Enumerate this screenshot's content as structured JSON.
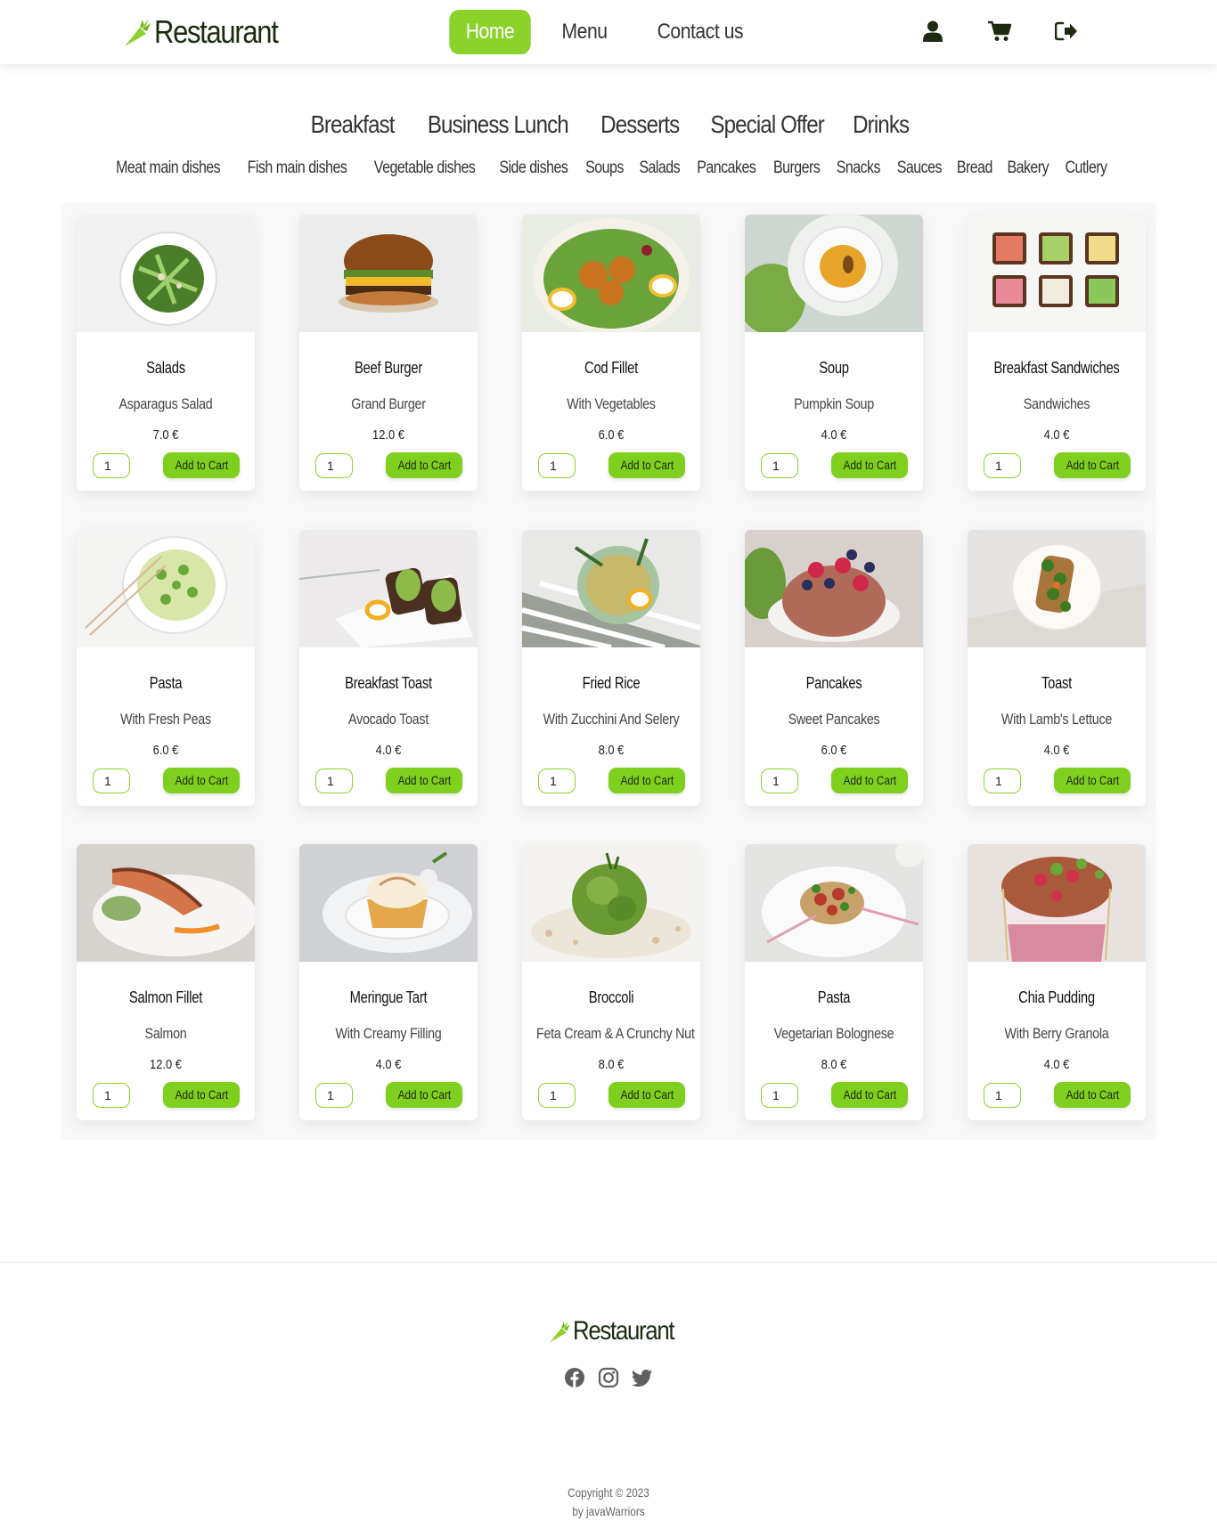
{
  "colors": {
    "accent": "#8bd22b",
    "button": "#7fcf1f",
    "text": "#333333"
  },
  "brand": {
    "name": "Restaurant",
    "logo_icon": "carrot-icon"
  },
  "nav": {
    "items": [
      {
        "label": "Home",
        "active": true
      },
      {
        "label": "Menu",
        "active": false
      },
      {
        "label": "Contact us",
        "active": false
      }
    ],
    "icons": [
      "user-icon",
      "cart-icon",
      "logout-icon"
    ]
  },
  "categories": {
    "main": [
      "Breakfast",
      "Business Lunch",
      "Desserts",
      "Special Offer",
      "Drinks"
    ],
    "sub": [
      "Meat main dishes",
      "Fish main dishes",
      "Vegetable dishes",
      "Side dishes",
      "Soups",
      "Salads",
      "Pancakes",
      "Burgers",
      "Snacks",
      "Sauces",
      "Bread",
      "Bakery",
      "Cutlery"
    ]
  },
  "add_to_cart_label": "Add to Cart",
  "products": [
    {
      "name": "Salads",
      "description": "Asparagus Salad",
      "price": "7.0 €",
      "quantity": "1"
    },
    {
      "name": "Beef Burger",
      "description": "Grand Burger",
      "price": "12.0 €",
      "quantity": "1"
    },
    {
      "name": "Cod Fillet",
      "description": "With Vegetables",
      "price": "6.0 €",
      "quantity": "1"
    },
    {
      "name": "Soup",
      "description": "Pumpkin Soup",
      "price": "4.0 €",
      "quantity": "1"
    },
    {
      "name": "Breakfast Sandwiches",
      "description": "Sandwiches",
      "price": "4.0 €",
      "quantity": "1"
    },
    {
      "name": "Pasta",
      "description": "With Fresh Peas",
      "price": "6.0 €",
      "quantity": "1"
    },
    {
      "name": "Breakfast Toast",
      "description": "Avocado Toast",
      "price": "4.0 €",
      "quantity": "1"
    },
    {
      "name": "Fried Rice",
      "description": "With Zucchini And Selery",
      "price": "8.0 €",
      "quantity": "1"
    },
    {
      "name": "Pancakes",
      "description": "Sweet Pancakes",
      "price": "6.0 €",
      "quantity": "1"
    },
    {
      "name": "Toast",
      "description": "With Lamb's Lettuce",
      "price": "4.0 €",
      "quantity": "1"
    },
    {
      "name": "Salmon Fillet",
      "description": "Salmon",
      "price": "12.0 €",
      "quantity": "1"
    },
    {
      "name": "Meringue Tart",
      "description": "With Creamy Filling",
      "price": "4.0 €",
      "quantity": "1"
    },
    {
      "name": "Broccoli",
      "description": "Feta Cream & A Crunchy Nut",
      "price": "8.0 €",
      "quantity": "1"
    },
    {
      "name": "Pasta",
      "description": "Vegetarian Bolognese",
      "price": "8.0 €",
      "quantity": "1"
    },
    {
      "name": "Chia Pudding",
      "description": "With Berry Granola",
      "price": "4.0 €",
      "quantity": "1"
    }
  ],
  "footer": {
    "brand": "Restaurant",
    "social": [
      "facebook-icon",
      "instagram-icon",
      "twitter-icon"
    ],
    "copyright": "Copyright © 2023",
    "credit": "by javaWarriors"
  }
}
